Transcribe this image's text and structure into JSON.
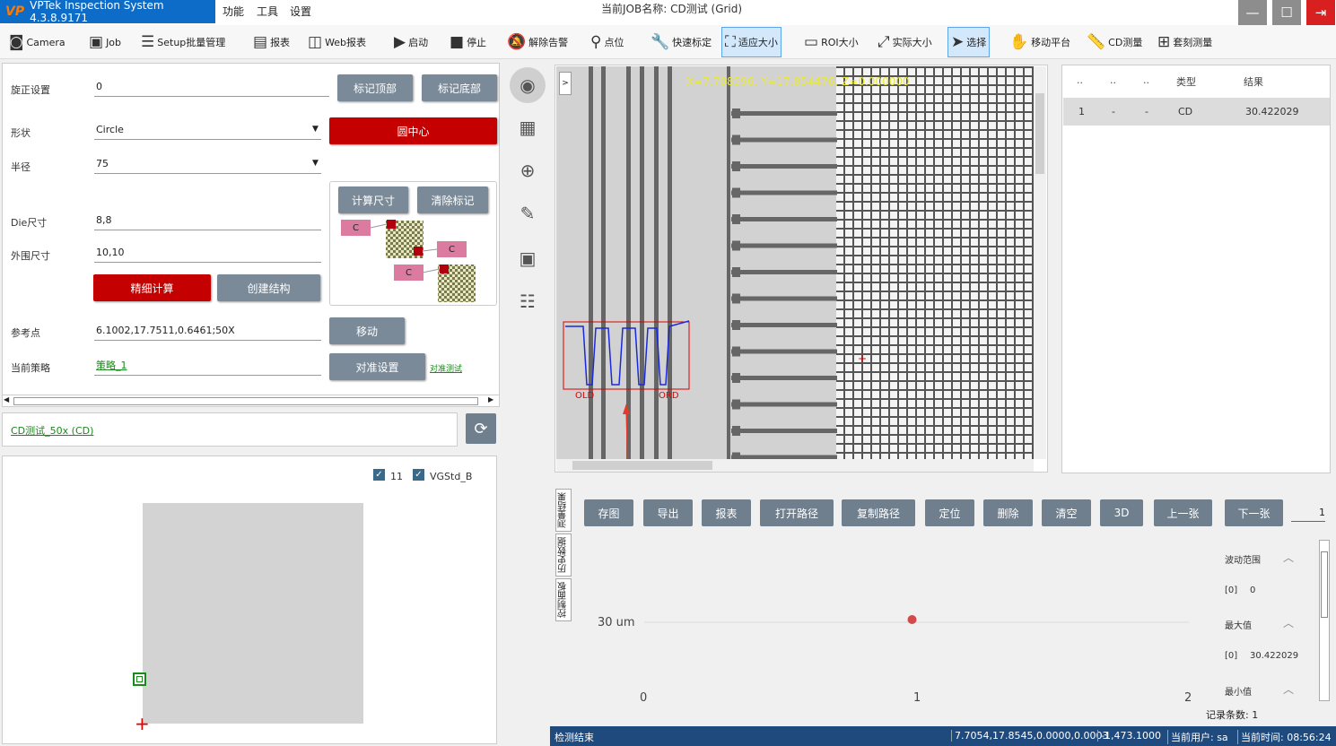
{
  "app": {
    "logo": "VP",
    "title": "VPTek Inspection System 4.3.8.9171",
    "menus": [
      "功能",
      "工具",
      "设置"
    ],
    "job_label": "当前JOB名称: CD测试 (Grid)"
  },
  "window": {
    "minimize": "—",
    "maximize": "☐",
    "exit": "⇥"
  },
  "toolbar": [
    {
      "icon": "camera-icon",
      "glyph": "◙",
      "label": "Camera",
      "x": 7
    },
    {
      "icon": "briefcase-icon",
      "glyph": "▣",
      "label": "Job",
      "x": 96
    },
    {
      "icon": "checklist-icon",
      "glyph": "☰",
      "label": "Setup批量管理",
      "x": 154
    },
    {
      "icon": "report-icon",
      "glyph": "▤",
      "label": "报表",
      "x": 279
    },
    {
      "icon": "web-report-icon",
      "glyph": "◫",
      "label": "Web报表",
      "x": 340
    },
    {
      "icon": "play-icon",
      "glyph": "▶",
      "label": "启动",
      "x": 436
    },
    {
      "icon": "stop-icon",
      "glyph": "■",
      "label": "停止",
      "x": 498
    },
    {
      "icon": "bell-off-icon",
      "glyph": "🔕",
      "label": "解除告警",
      "x": 562
    },
    {
      "icon": "pin-icon",
      "glyph": "⚲",
      "label": "点位",
      "x": 655
    },
    {
      "icon": "wrench-icon",
      "glyph": "🔧",
      "label": "快速标定",
      "x": 722
    },
    {
      "icon": "fit-icon",
      "glyph": "⛶",
      "label": "适应大小",
      "x": 804,
      "active": true
    },
    {
      "icon": "roi-icon",
      "glyph": "▭",
      "label": "ROI大小",
      "x": 893
    },
    {
      "icon": "fullsize-icon",
      "glyph": "⤢",
      "label": "实际大小",
      "x": 975
    },
    {
      "icon": "cursor-icon",
      "glyph": "➤",
      "label": "选择",
      "x": 1056,
      "active": true
    },
    {
      "icon": "hand-icon",
      "glyph": "✋",
      "label": "移动平台",
      "x": 1122
    },
    {
      "icon": "ruler-icon",
      "glyph": "📏",
      "label": "CD测量",
      "x": 1208
    },
    {
      "icon": "plus-icon",
      "glyph": "⊞",
      "label": "套刻测量",
      "x": 1287
    }
  ],
  "settings": {
    "rotation_label": "旋正设置",
    "rotation_value": "0",
    "mark_top": "标记顶部",
    "mark_bottom": "标记底部",
    "shape_label": "形状",
    "shape_value": "Circle",
    "circle_center": "圆中心",
    "radius_label": "半径",
    "radius_value": "75",
    "calc_size": "计算尺寸",
    "clear_marks": "清除标记",
    "die_label": "Die尺寸",
    "die_value": "8,8",
    "outer_label": "外围尺寸",
    "outer_value": "10,10",
    "fine_calc": "精细计算",
    "create_struct": "创建结构",
    "ref_label": "参考点",
    "ref_value": "6.1002,17.7511,0.6461;50X",
    "move": "移动",
    "strategy_label": "当前策略",
    "strategy_value": "策略_1",
    "align_settings": "对准设置",
    "align_test": "对准测试",
    "diagram_tag": "C"
  },
  "recipe": "CD测试_50x (CD)",
  "lower_left": {
    "cb1_label": "11",
    "cb2_label": "VGStd_B"
  },
  "image": {
    "toggle": ">",
    "coords": "X=7.708596, Y=17.854476, Z=0.000000",
    "old_label": "OLD",
    "ord_label": "ORD"
  },
  "results": {
    "headers": [
      "..",
      "..",
      "..",
      "类型",
      "结果"
    ],
    "row": [
      "1",
      "-",
      "-",
      "CD",
      "30.422029"
    ]
  },
  "tabs": [
    "测量结果",
    "历史数据",
    "控制面板"
  ],
  "actions": [
    "存图",
    "导出",
    "报表",
    "打开路径",
    "复制路径",
    "定位",
    "删除",
    "清空",
    "3D",
    "上一张",
    "下一张"
  ],
  "page_index": "1",
  "chart_data": {
    "type": "scatter",
    "x": [
      1
    ],
    "y": [
      30.422029
    ],
    "y_label": "30 um",
    "x_ticks": [
      "0",
      "1",
      "2"
    ],
    "xlim": [
      0,
      2
    ]
  },
  "stats": {
    "range_label": "波动范围",
    "range_idx": "[0]",
    "range_val": "0",
    "max_label": "最大值",
    "max_idx": "[0]",
    "max_val": "30.422029",
    "min_label": "最小值",
    "count": "记录条数: 1"
  },
  "status": {
    "left": "检测结束",
    "pos": "7.7054,17.8545,0.0000,0.0003",
    "val": "-1,473.1000",
    "user": "当前用户: sa",
    "time": "当前时间: 08:56:24"
  }
}
